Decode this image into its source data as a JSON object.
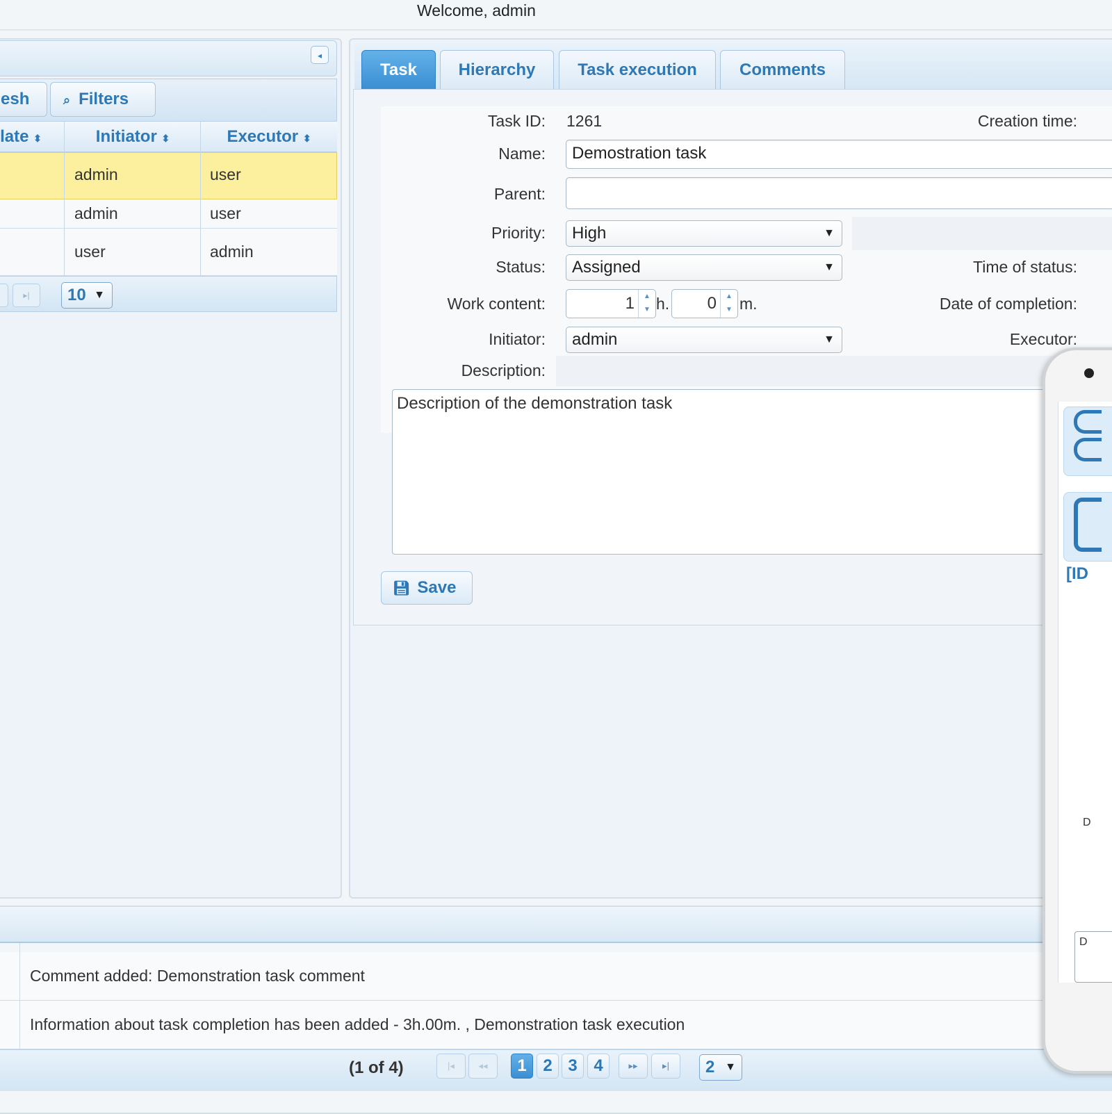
{
  "header": {
    "welcome": "Welcome, admin"
  },
  "left_panel": {
    "toolbar": {
      "refresh_label": "esh",
      "filters_label": "Filters"
    },
    "columns": [
      "late",
      "Initiator",
      "Executor"
    ],
    "rows": [
      {
        "initiator": "admin",
        "executor": "user"
      },
      {
        "initiator": "admin",
        "executor": "user"
      },
      {
        "initiator": "user",
        "executor": "admin"
      }
    ],
    "page_size": "10"
  },
  "tabs": [
    "Task",
    "Hierarchy",
    "Task execution",
    "Comments"
  ],
  "form": {
    "task_id_label": "Task ID:",
    "task_id": "1261",
    "creation_time_label": "Creation time:",
    "name_label": "Name:",
    "name_value": "Demostration task",
    "parent_label": "Parent:",
    "parent_value": "",
    "priority_label": "Priority:",
    "priority_value": "High",
    "status_label": "Status:",
    "status_value": "Assigned",
    "time_of_status_label": "Time of status:",
    "work_content_label": "Work content:",
    "hours_value": "1",
    "hours_unit": "h.",
    "minutes_value": "0",
    "minutes_unit": "m.",
    "date_of_completion_label": "Date of completion:",
    "initiator_label": "Initiator:",
    "initiator_value": "admin",
    "executor_label": "Executor:",
    "description_label": "Description:",
    "description_value": "Description of the demonstration task",
    "save_label": "Save"
  },
  "bottom_panel": {
    "entries": [
      "Comment added: Demonstration task comment",
      "Information about task completion has been added - 3h.00m. , Demonstration task execution"
    ],
    "pager_text": "(1 of 4)",
    "pages": [
      "1",
      "2",
      "3",
      "4"
    ],
    "page_size": "2"
  },
  "phone_overlay": {
    "label": "[ID",
    "letter1": "D",
    "letter2": "D"
  },
  "colors": {
    "accent": "#2d78b5",
    "active_tab": "#3a8fd3",
    "selected_row": "#fcef9e"
  }
}
